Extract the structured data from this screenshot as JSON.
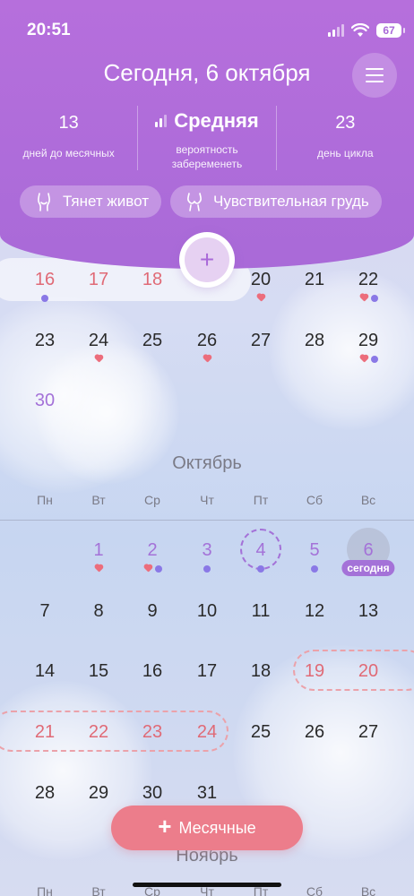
{
  "status": {
    "time": "20:51",
    "battery": "67"
  },
  "header": {
    "title": "Сегодня, 6 октября",
    "stats": [
      {
        "value": "13",
        "label_line1": "дней до месячных",
        "label_line2": ""
      },
      {
        "value": "Средняя",
        "label_line1": "вероятность",
        "label_line2": "забеременеть"
      },
      {
        "value": "23",
        "label_line1": "день цикла",
        "label_line2": ""
      }
    ],
    "chips": [
      {
        "label": "Тянет живот"
      },
      {
        "label": "Чувствительная грудь"
      }
    ]
  },
  "add_button": {
    "label": "+"
  },
  "september": {
    "days": [
      {
        "label": "16",
        "type": "period",
        "marks": [
          "dot"
        ]
      },
      {
        "label": "17",
        "type": "period",
        "marks": []
      },
      {
        "label": "18",
        "type": "period",
        "marks": []
      },
      {
        "label": "20",
        "type": "normal",
        "marks": [
          "heart"
        ]
      },
      {
        "label": "21",
        "type": "normal",
        "marks": []
      },
      {
        "label": "22",
        "type": "normal",
        "marks": [
          "heart",
          "dot"
        ]
      },
      {
        "label": "23",
        "type": "normal",
        "marks": []
      },
      {
        "label": "24",
        "type": "normal",
        "marks": [
          "heart"
        ]
      },
      {
        "label": "25",
        "type": "normal",
        "marks": []
      },
      {
        "label": "26",
        "type": "normal",
        "marks": [
          "heart"
        ]
      },
      {
        "label": "27",
        "type": "normal",
        "marks": []
      },
      {
        "label": "28",
        "type": "normal",
        "marks": []
      },
      {
        "label": "29",
        "type": "normal",
        "marks": [
          "heart",
          "dot"
        ]
      },
      {
        "label": "30",
        "type": "fertile",
        "marks": []
      }
    ]
  },
  "october": {
    "title": "Октябрь",
    "weekdays": [
      "Пн",
      "Вт",
      "Ср",
      "Чт",
      "Пт",
      "Сб",
      "Вс"
    ],
    "today_label": "сегодня",
    "days": [
      {
        "label": "1",
        "type": "fertile",
        "marks": [
          "heart"
        ]
      },
      {
        "label": "2",
        "type": "fertile",
        "marks": [
          "heart",
          "dot"
        ]
      },
      {
        "label": "3",
        "type": "fertile",
        "marks": [
          "dot"
        ]
      },
      {
        "label": "4",
        "type": "fertile",
        "marks": [
          "dot"
        ]
      },
      {
        "label": "5",
        "type": "fertile",
        "marks": [
          "dot"
        ]
      },
      {
        "label": "6",
        "type": "fertile",
        "marks": [
          "dot"
        ]
      },
      {
        "label": "7",
        "type": "normal",
        "marks": []
      },
      {
        "label": "8",
        "type": "normal",
        "marks": []
      },
      {
        "label": "9",
        "type": "normal",
        "marks": []
      },
      {
        "label": "10",
        "type": "normal",
        "marks": []
      },
      {
        "label": "11",
        "type": "normal",
        "marks": []
      },
      {
        "label": "12",
        "type": "normal",
        "marks": []
      },
      {
        "label": "13",
        "type": "normal",
        "marks": []
      },
      {
        "label": "14",
        "type": "normal",
        "marks": []
      },
      {
        "label": "15",
        "type": "normal",
        "marks": []
      },
      {
        "label": "16",
        "type": "normal",
        "marks": []
      },
      {
        "label": "17",
        "type": "normal",
        "marks": []
      },
      {
        "label": "18",
        "type": "normal",
        "marks": []
      },
      {
        "label": "19",
        "type": "period",
        "marks": []
      },
      {
        "label": "20",
        "type": "period",
        "marks": []
      },
      {
        "label": "21",
        "type": "period",
        "marks": []
      },
      {
        "label": "22",
        "type": "period",
        "marks": []
      },
      {
        "label": "23",
        "type": "period",
        "marks": []
      },
      {
        "label": "24",
        "type": "period",
        "marks": []
      },
      {
        "label": "25",
        "type": "normal",
        "marks": []
      },
      {
        "label": "26",
        "type": "normal",
        "marks": []
      },
      {
        "label": "27",
        "type": "normal",
        "marks": []
      },
      {
        "label": "28",
        "type": "normal",
        "marks": []
      },
      {
        "label": "29",
        "type": "normal",
        "marks": []
      },
      {
        "label": "30",
        "type": "normal",
        "marks": []
      },
      {
        "label": "31",
        "type": "normal",
        "marks": []
      }
    ]
  },
  "november": {
    "title": "Ноябрь",
    "weekdays": [
      "Пн",
      "Вт",
      "Ср",
      "Чт",
      "Пт",
      "Сб",
      "Вс"
    ]
  },
  "period_button": {
    "label": "Месячные"
  },
  "colors": {
    "header": "#b66fdc",
    "period": "#e06a76",
    "fertile": "#a472d8",
    "accent_button": "#ec7d8b"
  }
}
